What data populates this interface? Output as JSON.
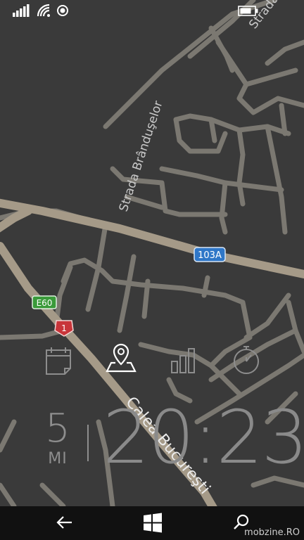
{
  "status_bar": {
    "icons": [
      "signal-bars-icon",
      "wifi-icon",
      "location-ring-icon",
      "battery-icon"
    ]
  },
  "map": {
    "street_labels": [
      "Strada",
      "Strada Brânduşelor",
      "Calea Bucureşti"
    ],
    "road_badges": [
      "103A",
      "E60",
      "1"
    ],
    "colors": {
      "background": "#3a3a3a",
      "road": "#7b7871",
      "main_road": "#a59a88",
      "badge_blue": "#2f77c8",
      "badge_green": "#3a9a3a",
      "badge_red": "#c8353a"
    }
  },
  "lock_screen_icons": [
    "calendar-icon",
    "location-pin-icon",
    "bar-chart-icon",
    "stopwatch-icon"
  ],
  "date": {
    "day": "5",
    "weekday": "MI"
  },
  "clock": {
    "time": "20:23"
  },
  "nav_bar": {
    "buttons": [
      "back-arrow-icon",
      "windows-logo-icon",
      "search-icon"
    ]
  },
  "watermark": "mobzine.RO"
}
